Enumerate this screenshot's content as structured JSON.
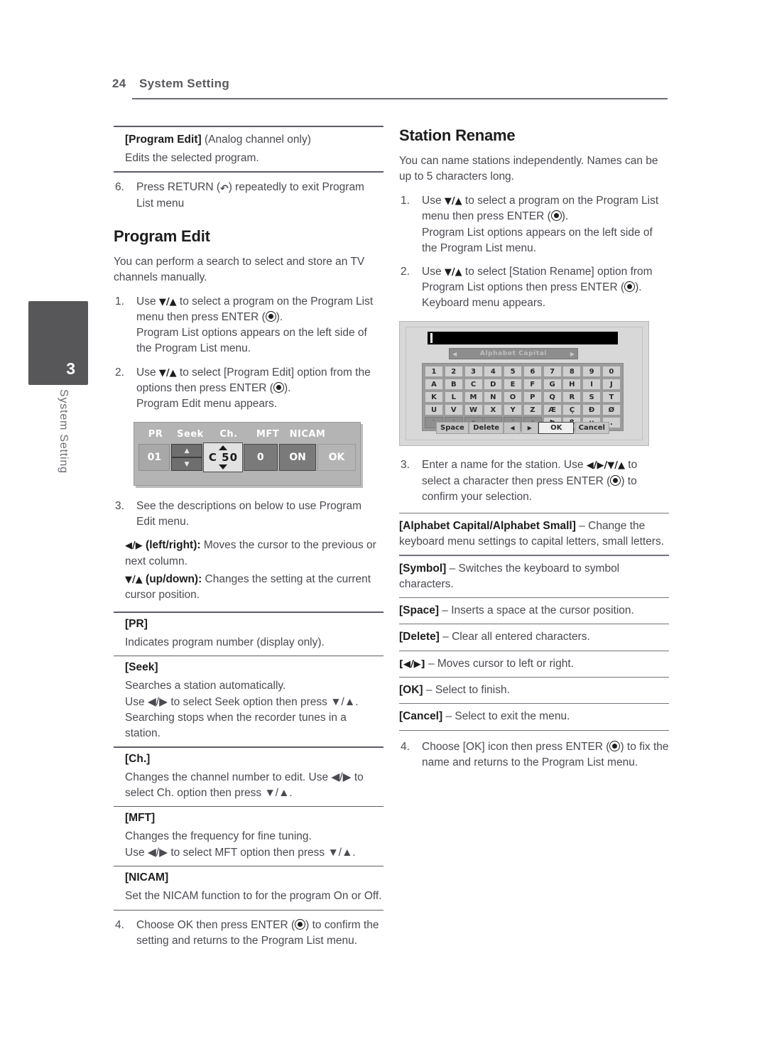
{
  "header": {
    "page_number": "24",
    "title": "System Setting"
  },
  "side_tab": {
    "number": "3",
    "label": "System Setting"
  },
  "left_column": {
    "program_edit_note": {
      "term": "[Program Edit]",
      "qualifier": " (Analog channel only)",
      "description": "Edits the selected program."
    },
    "step6": {
      "num": "6.",
      "text_before": "Press RETURN (",
      "icon": "return-icon",
      "text_after": ") repeatedly to exit Program List menu"
    },
    "heading": "Program Edit",
    "intro": "You can perform a search to select and store an TV channels manually.",
    "step1": {
      "num": "1.",
      "line1_a": "Use ",
      "line1_arrows": "▼/▲",
      "line1_b": " to select a program on the Program List menu then press ENTER (",
      "line1_c": ").",
      "line2": "Program List options appears on the left side of the Program List menu."
    },
    "step2": {
      "num": "2.",
      "line1_a": "Use ",
      "line1_arrows": "▼/▲",
      "line1_b": " to select [Program Edit] option from the options then press ENTER (",
      "line1_c": ").",
      "line2": "Program Edit menu appears."
    },
    "step3": {
      "num": "3.",
      "text": "See the descriptions on below to use Program Edit menu."
    },
    "leftright": {
      "arrows": "◀/▶",
      "term": " (left/right):",
      "description": " Moves the cursor to the previous or next column."
    },
    "updown": {
      "arrows": "▼/▲",
      "term": " (up/down):",
      "description": " Changes the setting at the current cursor position."
    },
    "definitions": [
      {
        "term": "[PR]",
        "description": "Indicates program number (display only)."
      },
      {
        "term": "[Seek]",
        "description": "Searches a station automatically.\nUse ◀/▶ to select Seek option then press ▼/▲. Searching stops when the recorder tunes in a station."
      },
      {
        "term": "[Ch.]",
        "description": "Changes the channel number to edit. Use ◀/▶ to select Ch. option then press ▼/▲."
      },
      {
        "term": "[MFT]",
        "description": "Changes the frequency for fine tuning.\nUse ◀/▶ to select MFT option then press ▼/▲."
      },
      {
        "term": "[NICAM]",
        "description": "Set the NICAM function to for the program On or Off."
      }
    ],
    "step4": {
      "num": "4.",
      "line1_a": "Choose OK then press ENTER (",
      "line1_b": ") to confirm the setting and returns to the Program List menu."
    }
  },
  "program_edit_osd": {
    "columns": [
      "PR",
      "Seek",
      "Ch.",
      "MFT",
      "NICAM"
    ],
    "pr_value": "01",
    "seek_up": "▲",
    "seek_down": "▼",
    "ch_value": "C 50",
    "mft_value": "0",
    "nicam_value": "ON",
    "ok_label": "OK"
  },
  "right_column": {
    "heading": "Station Rename",
    "intro": "You can name stations independently. Names can be up to 5 characters long.",
    "step1": {
      "num": "1.",
      "line1_a": "Use ",
      "line1_arrows": "▼/▲",
      "line1_b": " to select a program on the Program List menu then press ENTER (",
      "line1_c": ").",
      "line2": "Program List options appears on the left side of the Program List menu."
    },
    "step2": {
      "num": "2.",
      "line1_a": "Use ",
      "line1_arrows": "▼/▲",
      "line1_b": " to select [Station Rename] option from Program List options then press ENTER (",
      "line1_c": "). Keyboard menu appears."
    },
    "step3": {
      "num": "3.",
      "line1_a": "Enter a name for the station. Use ",
      "line1_arrows": "◀/▶/▼/▲",
      "line1_b": " to select a character then press ENTER (",
      "line1_c": ") to confirm your selection."
    },
    "definitions": [
      {
        "term": "[Alphabet Capital/Alphabet Small]",
        "separator": " – ",
        "description": "Change the keyboard menu settings to capital letters, small letters."
      },
      {
        "term": "[Symbol]",
        "separator": " – ",
        "description": "Switches the keyboard to symbol characters."
      },
      {
        "term": "[Space]",
        "separator": " – ",
        "description": "Inserts a space at the cursor position."
      },
      {
        "term": "[Delete]",
        "separator": " – ",
        "description": "Clear all entered characters."
      },
      {
        "term": "[◀/▶]",
        "separator": " – ",
        "description": "Moves cursor to left or right."
      },
      {
        "term": "[OK]",
        "separator": " – ",
        "description": "Select to finish."
      },
      {
        "term": "[Cancel]",
        "separator": " – ",
        "description": "Select to exit the menu."
      }
    ],
    "step4": {
      "num": "4.",
      "line1_a": "Choose [OK] icon then press ENTER (",
      "line1_b": ") to fix the name and returns to the Program List menu."
    }
  },
  "keyboard_osd": {
    "text_value": "",
    "mode_label": "Alphabet Capital",
    "mode_prev_arrow": "◀",
    "mode_next_arrow": "▶",
    "rows": [
      [
        "1",
        "2",
        "3",
        "4",
        "5",
        "6",
        "7",
        "8",
        "9",
        "0"
      ],
      [
        "A",
        "B",
        "C",
        "D",
        "E",
        "F",
        "G",
        "H",
        "I",
        "J"
      ],
      [
        "K",
        "L",
        "M",
        "N",
        "O",
        "P",
        "Q",
        "R",
        "S",
        "T"
      ],
      [
        "U",
        "V",
        "W",
        "X",
        "Y",
        "Z",
        "Æ",
        "Ç",
        "Ð",
        "Ø"
      ],
      [
        "`",
        "´",
        "^",
        "~",
        "¨",
        "°",
        "Þ",
        "ß",
        "µ",
        "."
      ]
    ],
    "accent_row_index": 4,
    "accent_count": 6,
    "actions": {
      "space": "Space",
      "delete": "Delete",
      "left": "◀",
      "right": "▶",
      "ok": "OK",
      "cancel": "Cancel"
    }
  },
  "colors": {
    "text": "#4a4a52",
    "heading": "#1d1d1f",
    "header_gray": "#59595f",
    "tab_bg": "#57575a",
    "osd_bg": "#b4b4b4",
    "keyboard_bg": "#d8d8d8"
  }
}
